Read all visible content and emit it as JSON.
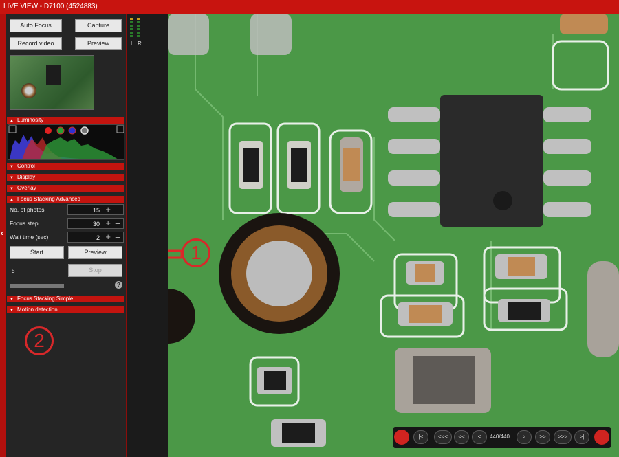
{
  "window": {
    "title": "LIVE VIEW - D7100 (4524883)"
  },
  "buttons": {
    "auto_focus": "Auto Focus",
    "capture": "Capture",
    "record_video": "Record video",
    "preview": "Preview"
  },
  "meter": {
    "left": "L",
    "right": "R"
  },
  "sections": {
    "luminosity": "Luminosity",
    "control": "Control",
    "display": "Display",
    "overlay": "Overlay",
    "focus_stacking_advanced": "Focus Stacking Advanced",
    "focus_stacking_simple": "Focus Stacking Simple",
    "motion_detection": "Motion detection"
  },
  "focus_stacking": {
    "photos_label": "No. of photos",
    "photos_value": "15",
    "step_label": "Focus step",
    "step_value": "30",
    "wait_label": "Wait time (sec)",
    "wait_value": "2",
    "start": "Start",
    "preview": "Preview",
    "stop": "Stop",
    "counter": "5",
    "help": "?"
  },
  "annotations": {
    "one": "1",
    "two": "2"
  },
  "navigator": {
    "first": "|<",
    "back_fast": "<<<",
    "back": "<<",
    "prev": "<",
    "position": "440/440",
    "next": ">",
    "forward": ">>",
    "forward_fast": ">>>",
    "last": ">|"
  },
  "colors": {
    "accent": "#c8140f",
    "panel": "#252525",
    "pcb": "#4e9a4c"
  }
}
